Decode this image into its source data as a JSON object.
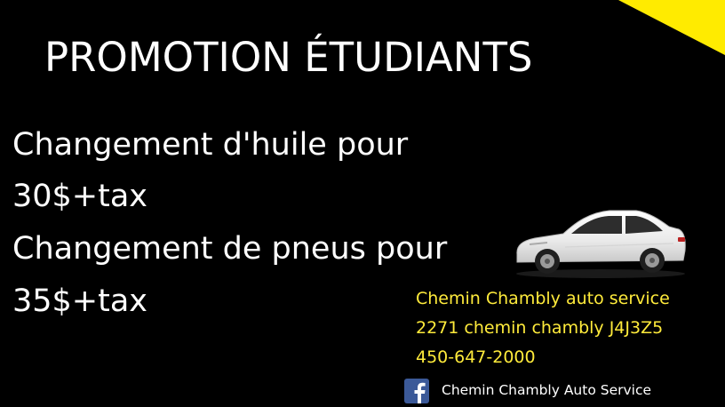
{
  "colors": {
    "background": "#000000",
    "headline_text": "#ffffff",
    "contact_text": "#ffeb3b",
    "accent_corner": "#ffeb00",
    "facebook_blue": "#3b5998"
  },
  "headline": {
    "title": "PROMOTION ÉTUDIANTS"
  },
  "offers": [
    {
      "service": "Changement d'huile pour",
      "price": "30$+tax"
    },
    {
      "service": "Changement de pneus pour",
      "price": "35$+tax"
    }
  ],
  "contact": {
    "business_name": "Chemin Chambly auto service",
    "address": "2271 chemin chambly J4J3Z5",
    "phone": "450-647-2000"
  },
  "social": {
    "icon": "facebook-icon",
    "page_name": "Chemin Chambly Auto Service"
  },
  "illustration": {
    "icon": "car-icon"
  }
}
